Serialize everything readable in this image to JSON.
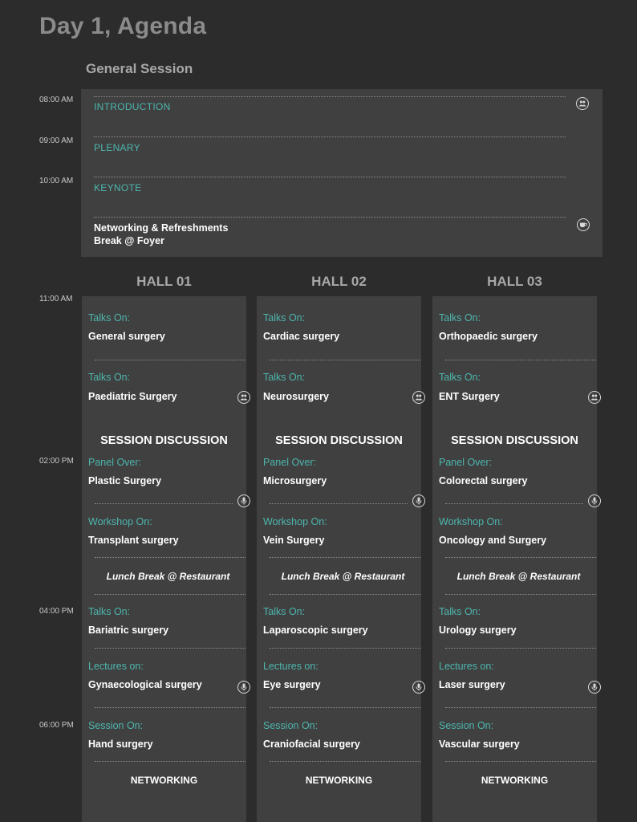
{
  "page_title": "Day 1, Agenda",
  "general_session": {
    "title": "General Session",
    "times": [
      "08:00 AM",
      "09:00 AM",
      "10:00 AM"
    ],
    "items": [
      {
        "label": "INTRODUCTION",
        "icon": "people-icon"
      },
      {
        "label": "PLENARY"
      },
      {
        "label": "KEYNOTE"
      },
      {
        "line1": "Networking & Refreshments",
        "line2": "Break @ Foyer",
        "icon": "coffee-icon"
      }
    ]
  },
  "hall_times": [
    "11:00 AM",
    "02:00 PM",
    "04:00 PM",
    "06:00 PM"
  ],
  "halls": [
    {
      "name": "HALL 01",
      "talk1_label": "Talks On:",
      "talk1_value": "General surgery",
      "talk2_label": "Talks On:",
      "talk2_value": "Paediatric Surgery",
      "discussion": "SESSION DISCUSSION",
      "panel_label": "Panel Over:",
      "panel_value": "Plastic Surgery",
      "workshop_label": "Workshop On:",
      "workshop_value": "Transplant surgery",
      "lunch": "Lunch Break @ Restaurant",
      "talk3_label": "Talks On:",
      "talk3_value": "Bariatric surgery",
      "lectures_label": "Lectures on:",
      "lectures_value": "Gynaecological surgery",
      "session_label": "Session On:",
      "session_value": "Hand surgery",
      "networking": "NETWORKING"
    },
    {
      "name": "HALL 02",
      "talk1_label": "Talks On:",
      "talk1_value": "Cardiac surgery",
      "talk2_label": "Talks On:",
      "talk2_value": "Neurosurgery",
      "discussion": "SESSION DISCUSSION",
      "panel_label": "Panel Over:",
      "panel_value": "Microsurgery",
      "workshop_label": "Workshop On:",
      "workshop_value": "Vein Surgery",
      "lunch": "Lunch Break @ Restaurant",
      "talk3_label": "Talks On:",
      "talk3_value": "Laparoscopic surgery",
      "lectures_label": "Lectures on:",
      "lectures_value": "Eye surgery",
      "session_label": "Session On:",
      "session_value": "Craniofacial surgery",
      "networking": "NETWORKING"
    },
    {
      "name": "HALL 03",
      "talk1_label": "Talks On:",
      "talk1_value": "Orthopaedic surgery",
      "talk2_label": "Talks On:",
      "talk2_value": "ENT Surgery",
      "discussion": "SESSION DISCUSSION",
      "panel_label": "Panel Over:",
      "panel_value": "Colorectal surgery",
      "workshop_label": "Workshop On:",
      "workshop_value": "Oncology and Surgery",
      "lunch": "Lunch Break @ Restaurant",
      "talk3_label": "Talks On:",
      "talk3_value": "Urology surgery",
      "lectures_label": "Lectures on:",
      "lectures_value": "Laser surgery",
      "session_label": "Session On:",
      "session_value": "Vascular surgery",
      "networking": "NETWORKING"
    }
  ],
  "colors": {
    "background": "#2c2c2c",
    "panel": "#404040",
    "accent_teal": "#4cb6ad",
    "heading_grey": "#8b8b8b"
  }
}
